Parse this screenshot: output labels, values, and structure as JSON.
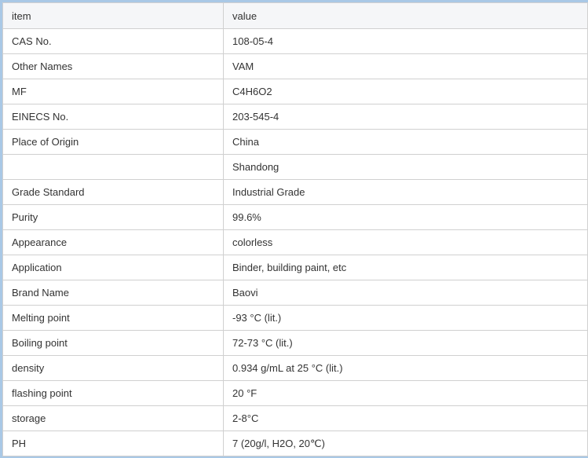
{
  "header": {
    "item": "item",
    "value": "value"
  },
  "rows": [
    {
      "item": "CAS No.",
      "value": "108-05-4"
    },
    {
      "item": "Other Names",
      "value": "VAM"
    },
    {
      "item": "MF",
      "value": "C4H6O2"
    },
    {
      "item": "EINECS No.",
      "value": "203-545-4"
    },
    {
      "item": "Place of Origin",
      "value": "China"
    },
    {
      "item": "",
      "value": "Shandong"
    },
    {
      "item": "Grade Standard",
      "value": "Industrial Grade"
    },
    {
      "item": "Purity",
      "value": "99.6%"
    },
    {
      "item": "Appearance",
      "value": "colorless"
    },
    {
      "item": "Application",
      "value": "Binder, building paint, etc"
    },
    {
      "item": "Brand Name",
      "value": "Baovi"
    },
    {
      "item": "Melting point",
      "value": "-93 °C (lit.)"
    },
    {
      "item": "Boiling point",
      "value": "72-73 °C (lit.)"
    },
    {
      "item": "density",
      "value": "0.934 g/mL at 25 °C (lit.)"
    },
    {
      "item": "flashing point",
      "value": "20 °F"
    },
    {
      "item": "storage",
      "value": "2-8°C"
    },
    {
      "item": "PH",
      "value": "7 (20g/l, H2O, 20℃)"
    }
  ]
}
